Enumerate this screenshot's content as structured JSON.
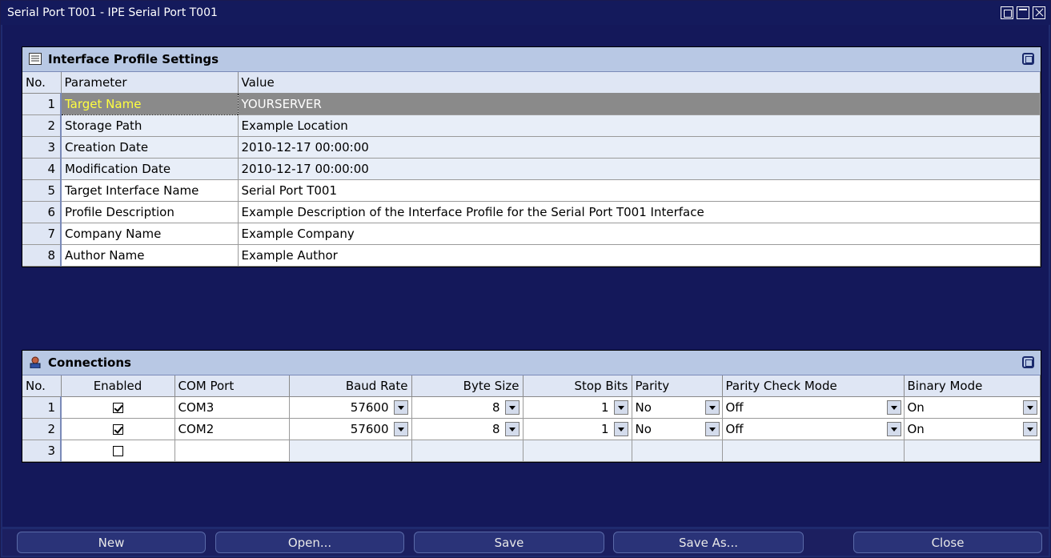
{
  "window": {
    "title": "Serial Port T001 - IPE Serial Port T001"
  },
  "profile_panel": {
    "title": "Interface Profile Settings",
    "columns": [
      "No.",
      "Parameter",
      "Value"
    ],
    "rows": [
      {
        "no": "1",
        "parameter": "Target Name",
        "value": "YOURSERVER"
      },
      {
        "no": "2",
        "parameter": "Storage Path",
        "value": "Example Location"
      },
      {
        "no": "3",
        "parameter": "Creation Date",
        "value": "2010-12-17 00:00:00"
      },
      {
        "no": "4",
        "parameter": "Modification Date",
        "value": "2010-12-17 00:00:00"
      },
      {
        "no": "5",
        "parameter": "Target Interface Name",
        "value": "Serial Port T001"
      },
      {
        "no": "6",
        "parameter": "Profile Description",
        "value": "Example Description of the Interface Profile for the Serial Port T001 Interface"
      },
      {
        "no": "7",
        "parameter": "Company Name",
        "value": "Example Company"
      },
      {
        "no": "8",
        "parameter": "Author Name",
        "value": "Example Author"
      }
    ]
  },
  "connections_panel": {
    "title": "Connections",
    "columns": [
      "No.",
      "Enabled",
      "COM Port",
      "Baud Rate",
      "Byte Size",
      "Stop Bits",
      "Parity",
      "Parity Check Mode",
      "Binary Mode"
    ],
    "rows": [
      {
        "no": "1",
        "enabled": true,
        "com_port": "COM3",
        "baud_rate": "57600",
        "byte_size": "8",
        "stop_bits": "1",
        "parity": "No",
        "parity_check_mode": "Off",
        "binary_mode": "On"
      },
      {
        "no": "2",
        "enabled": true,
        "com_port": "COM2",
        "baud_rate": "57600",
        "byte_size": "8",
        "stop_bits": "1",
        "parity": "No",
        "parity_check_mode": "Off",
        "binary_mode": "On"
      },
      {
        "no": "3",
        "enabled": false,
        "com_port": "",
        "baud_rate": "",
        "byte_size": "",
        "stop_bits": "",
        "parity": "",
        "parity_check_mode": "",
        "binary_mode": ""
      }
    ]
  },
  "buttons": {
    "new": "New",
    "open": "Open...",
    "save": "Save",
    "save_as": "Save As...",
    "close": "Close"
  },
  "colors": {
    "title_bar": "#141a5c",
    "selected_row": "#8a8a8a",
    "selected_param_text": "#ffff40",
    "header_bg": "#b8c8e4"
  }
}
